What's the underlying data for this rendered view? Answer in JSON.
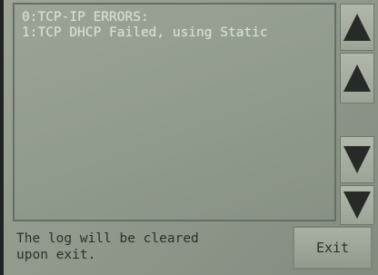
{
  "log": {
    "lines": [
      "0:TCP-IP ERRORS:",
      "1:TCP DHCP Failed, using Static"
    ]
  },
  "scroll_buttons": [
    {
      "icon": "arrow-up-icon"
    },
    {
      "icon": "arrow-up-icon"
    },
    {
      "icon": "arrow-down-icon"
    },
    {
      "icon": "arrow-down-icon"
    }
  ],
  "footer": {
    "message_line1": "The log will be cleared",
    "message_line2": "upon exit.",
    "exit_label": "Exit"
  }
}
